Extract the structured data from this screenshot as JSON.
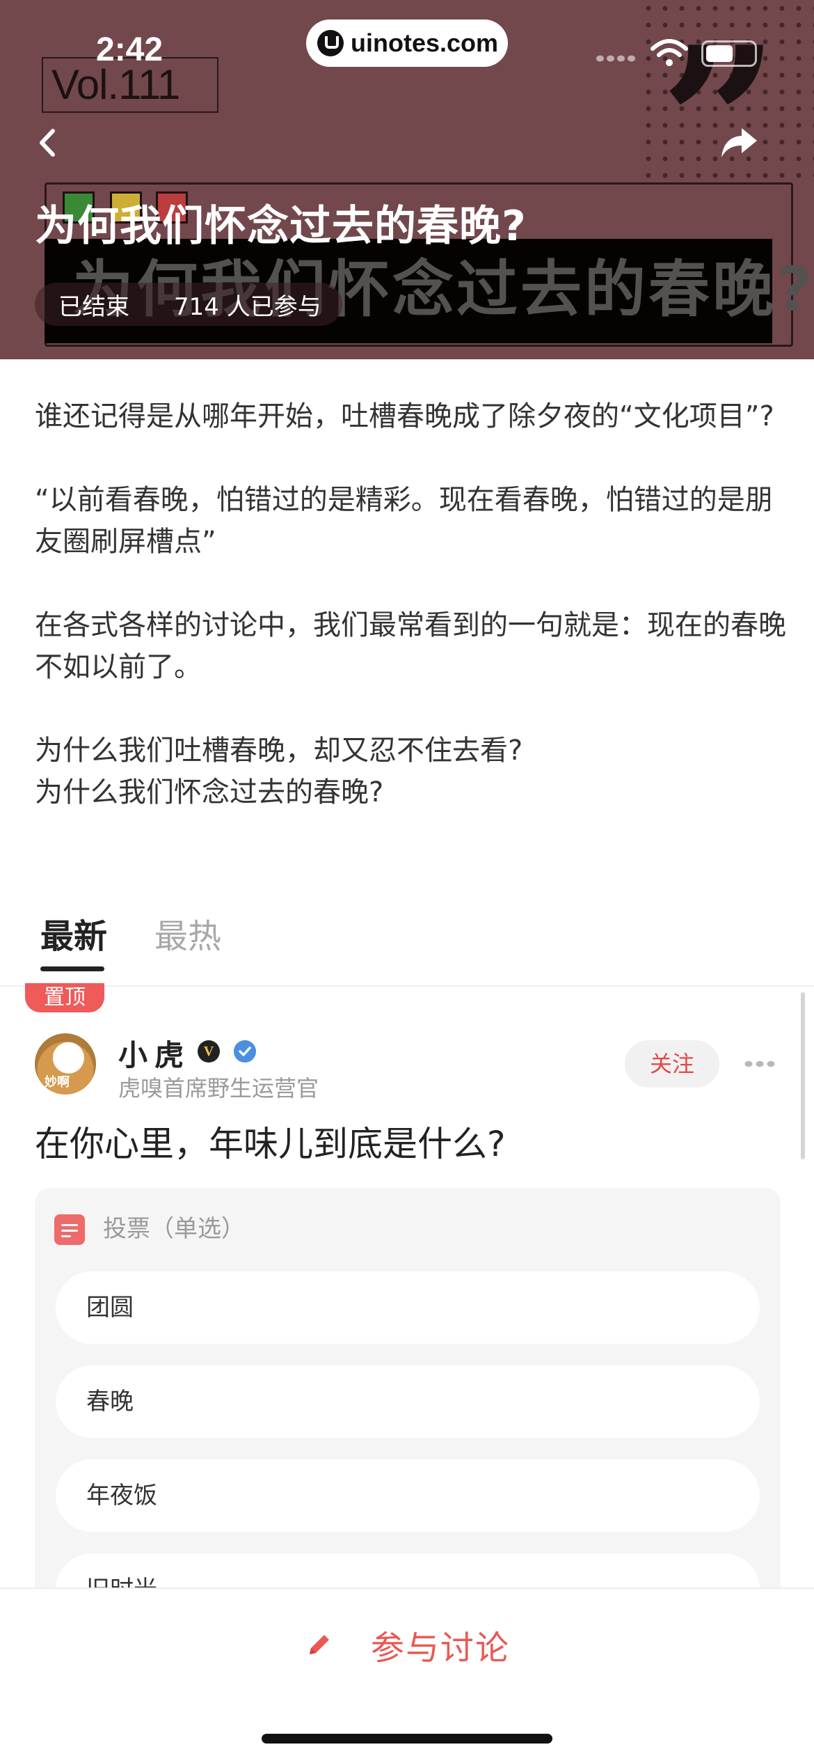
{
  "status_bar": {
    "time": "2:42",
    "url": "uinotes.com"
  },
  "hero": {
    "vol": "Vol.111",
    "decor_headline": "为何我们怀念过去的春晚?",
    "title": "为何我们怀念过去的春晚?",
    "status": "已结束",
    "participants": "714 人已参与",
    "bg_color": "#7d5055"
  },
  "description": {
    "p1": "谁还记得是从哪年开始，吐槽春晚成了除夕夜的“文化项目”?",
    "p2": "“以前看春晚，怕错过的是精彩。现在看春晚，怕错过的是朋友圈刷屏槽点”",
    "p3": "在各式各样的讨论中，我们最常看到的一句就是：现在的春晚不如以前了。",
    "p4a": "为什么我们吐槽春晚，却又忍不住去看?",
    "p4b": "为什么我们怀念过去的春晚?"
  },
  "tabs": {
    "latest": "最新",
    "hot": "最热"
  },
  "post": {
    "pinned": "置顶",
    "avatar_caption": "妙啊",
    "author": "小虎",
    "author_badge": "V",
    "author_title": "虎嗅首席野生运营官",
    "follow": "关注",
    "question": "在你心里，年味儿到底是什么?",
    "poll": {
      "label": "投票（单选）",
      "options": [
        "团圆",
        "春晚",
        "年夜饭",
        "旧时光"
      ]
    }
  },
  "bottom": {
    "participate": "参与讨论",
    "accent": "#e85a55"
  }
}
